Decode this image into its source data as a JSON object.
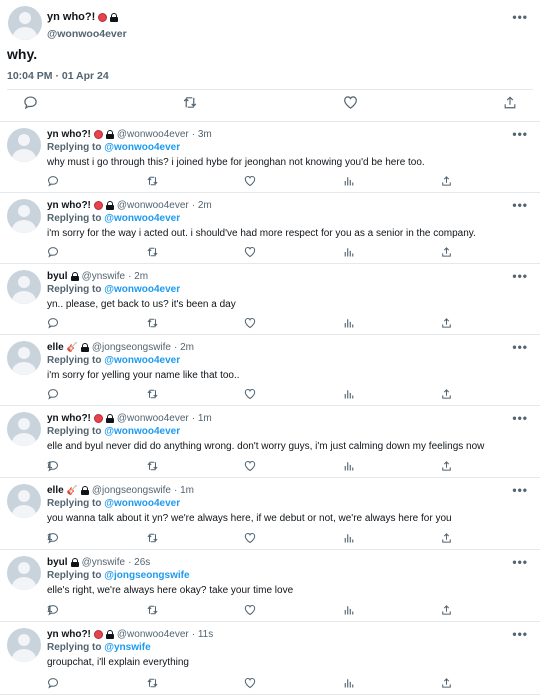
{
  "main": {
    "name": "yn who?!",
    "handle": "@wonwoo4ever",
    "text": "why.",
    "timestamp": "10:04 PM · 01 Apr 24"
  },
  "more_label": "•••",
  "replying_prefix": "Replying to",
  "replies": [
    {
      "name": "yn who?!",
      "badge": "red",
      "handle": "@wonwoo4ever",
      "time": "· 3m",
      "replying_to": "@wonwoo4ever",
      "text": "why must i go through this? i joined hybe for jeonghan not knowing you'd be here too.",
      "reply_count": ""
    },
    {
      "name": "yn who?!",
      "badge": "red",
      "handle": "@wonwoo4ever",
      "time": "· 2m",
      "replying_to": "@wonwoo4ever",
      "text": "i'm sorry for the way i acted out. i should've had more respect for you as a senior in the company.",
      "reply_count": ""
    },
    {
      "name": "byul",
      "badge": "",
      "handle": "@ynswife",
      "time": "· 2m",
      "replying_to": "@wonwoo4ever",
      "text": "yn.. please, get back to us? it's been a day",
      "reply_count": ""
    },
    {
      "name": "elle",
      "badge": "guitar",
      "handle": "@jongseongswife",
      "time": "· 2m",
      "replying_to": "@wonwoo4ever",
      "text": "i'm sorry for yelling your name like that too..",
      "reply_count": ""
    },
    {
      "name": "yn who?!",
      "badge": "red",
      "handle": "@wonwoo4ever",
      "time": "· 1m",
      "replying_to": "@wonwoo4ever",
      "text": "elle and byul never did do anything wrong. don't worry guys, i'm just calming down my feelings now",
      "reply_count": "1"
    },
    {
      "name": "elle",
      "badge": "guitar",
      "handle": "@jongseongswife",
      "time": "· 1m",
      "replying_to": "@wonwoo4ever",
      "text": "you wanna talk about it yn? we're always here, if we debut or not, we're always here for you",
      "reply_count": "1"
    },
    {
      "name": "byul",
      "badge": "",
      "handle": "@ynswife",
      "time": "· 26s",
      "replying_to": "@jongseongswife",
      "text": "elle's right, we're always here okay? take your time love",
      "reply_count": "1"
    },
    {
      "name": "yn who?!",
      "badge": "red",
      "handle": "@wonwoo4ever",
      "time": "· 11s",
      "replying_to": "@ynswife",
      "text": "groupchat, i'll explain everything",
      "reply_count": ""
    }
  ],
  "colors": {
    "link": "#1d9bf0",
    "muted": "#536471",
    "text": "#0f1419",
    "divider": "#e6e9ec"
  },
  "icons": [
    "reply-icon",
    "retweet-icon",
    "like-icon",
    "views-icon",
    "share-icon",
    "lock-icon",
    "more-icon"
  ]
}
